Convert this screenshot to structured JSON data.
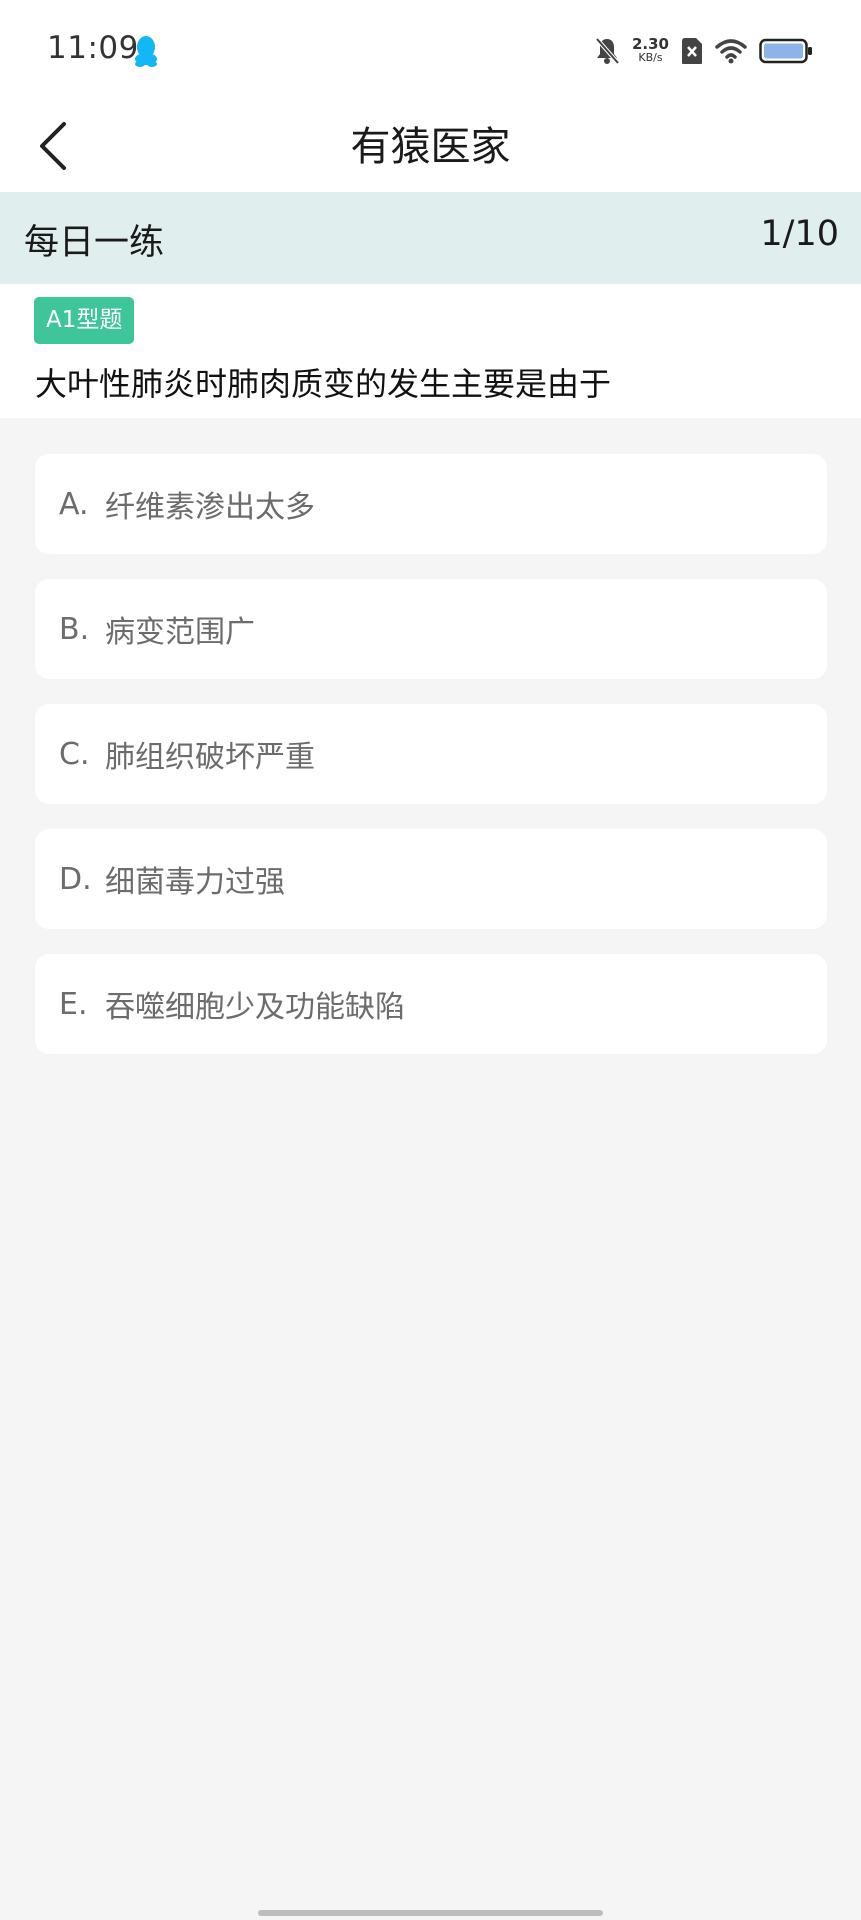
{
  "status_bar": {
    "time": "11:09",
    "net_speed_value": "2.30",
    "net_speed_unit": "KB/s",
    "icons": [
      "qq-icon",
      "bell-muted-icon",
      "sim-off-icon",
      "wifi-icon",
      "battery-icon"
    ]
  },
  "nav": {
    "title": "有猿医家"
  },
  "practice": {
    "title": "每日一练",
    "progress": "1/10"
  },
  "question": {
    "type": "A1型题",
    "text": "大叶性肺炎时肺肉质变的发生主要是由于"
  },
  "options": [
    {
      "letter": "A.",
      "text": "纤维素渗出太多"
    },
    {
      "letter": "B.",
      "text": "病变范围广"
    },
    {
      "letter": "C.",
      "text": "肺组织破坏严重"
    },
    {
      "letter": "D.",
      "text": "细菌毒力过强"
    },
    {
      "letter": "E.",
      "text": "吞噬细胞少及功能缺陷"
    }
  ],
  "colors": {
    "accent": "#3fc59a",
    "header_bg": "#e1eeee",
    "page_bg": "#f5f5f5"
  }
}
